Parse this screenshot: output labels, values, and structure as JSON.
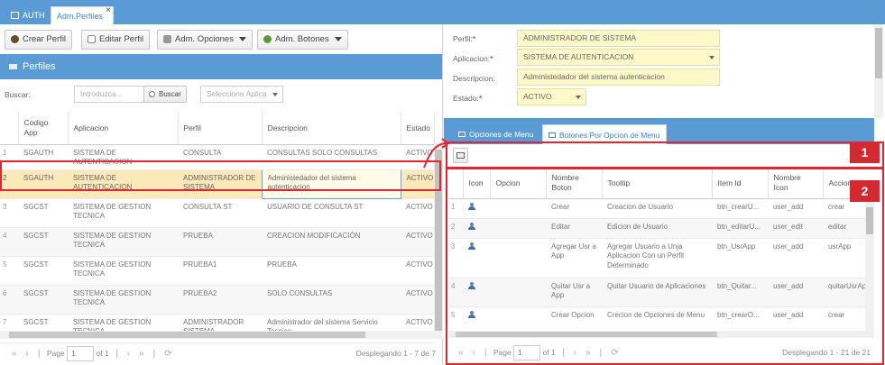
{
  "tabs": {
    "auth": "AUTH",
    "active": "Adm.Perfiles",
    "close": "×"
  },
  "toolbar": {
    "crear": "Crear Perfil",
    "editar": "Editar Perfil",
    "opciones": "Adm. Opciones",
    "botones": "Adm. Botones"
  },
  "left": {
    "title": "Perfiles",
    "search_label": "Buscar:",
    "search_placeholder": "Introduzca...",
    "search_button": "Buscar",
    "app_select_placeholder": "Seleccione Aplica",
    "columns": [
      "Codigo App",
      "Aplicacion",
      "Perfil",
      "Descripcion",
      "Estado"
    ],
    "rows": [
      {
        "n": "1",
        "codigo": "SGAUTH",
        "aplicacion": "SISTEMA DE AUTENTICACION",
        "perfil": "CONSULTA",
        "descripcion": "CONSULTAS SOLO CONSULTAS",
        "estado": "ACTIVO"
      },
      {
        "n": "2",
        "codigo": "SGAUTH",
        "aplicacion": "SISTEMA DE AUTENTICACION",
        "perfil": "ADMINISTRADOR DE SISTEMA",
        "descripcion": "Administedador del sistema autenticacion",
        "estado": "ACTIVO"
      },
      {
        "n": "3",
        "codigo": "SGCST",
        "aplicacion": "SISTEMA DE GESTION TECNICA",
        "perfil": "CONSULTA ST",
        "descripcion": "USUARIO DE CONSULTA ST",
        "estado": "ACTIVO"
      },
      {
        "n": "4",
        "codigo": "SGCST",
        "aplicacion": "SISTEMA DE GESTION TECNICA",
        "perfil": "PRUEBA",
        "descripcion": "CREACION MODIFICACIÓN",
        "estado": "ACTIVO"
      },
      {
        "n": "5",
        "codigo": "SGCST",
        "aplicacion": "SISTEMA DE GESTION TECNICA",
        "perfil": "PRUEBA1",
        "descripcion": "PRUEBA",
        "estado": "ACTIVO"
      },
      {
        "n": "6",
        "codigo": "SGCST",
        "aplicacion": "SISTEMA DE GESTION TECNICA",
        "perfil": "PRUEBA2",
        "descripcion": "SOLO CONSULTAS",
        "estado": "ACTIVO"
      },
      {
        "n": "7",
        "codigo": "SGCST",
        "aplicacion": "SISTEMA DE GESTION TECNICA",
        "perfil": "ADMINISTRADOR SISTEMA",
        "descripcion": "Administrador del sistema Servicio Tecnico",
        "estado": "ACTIVO"
      }
    ],
    "pager": {
      "page_label": "Page",
      "page_value": "1",
      "of": "of 1",
      "display": "Desplegando 1 - 7 de 7"
    }
  },
  "form": {
    "perfil_label": "Perfil:",
    "perfil_value": "ADMINISTRADOR DE SISTEMA",
    "app_label": "Aplicacion:",
    "app_value": "SISTEMA DE AUTENTICACION",
    "desc_label": "Descripcion:",
    "desc_value": "Administedador del sistema autenticacion",
    "estado_label": "Estado:",
    "estado_value": "ACTIVO",
    "required": "*"
  },
  "right_tabs": {
    "opciones": "Opciones de Menu",
    "botones": "Botones Por Opcion de Menu"
  },
  "right": {
    "columns": [
      "Icon",
      "Opcion",
      "Nombre Boton",
      "Tooltip",
      "Item Id",
      "Nombre Icon",
      "Accion"
    ],
    "rows": [
      {
        "n": "1",
        "icon": "user-icon",
        "opcion": "",
        "boton": "Crear",
        "tooltip": "Creacion de Usuario",
        "item": "btn_crearU...",
        "nicon": "user_add",
        "accion": "crear"
      },
      {
        "n": "2",
        "icon": "user-edit-icon",
        "opcion": "",
        "boton": "Editar",
        "tooltip": "Edicion de Usuario",
        "item": "btn_editarU...",
        "nicon": "user_edit",
        "accion": "editar"
      },
      {
        "n": "3",
        "icon": "user-icon",
        "opcion": "",
        "boton": "Agregar Usr a App",
        "tooltip": "Agregar Usuario a Unja Aplicacion Con un Perfil Determinado",
        "item": "btn_UsrApp",
        "nicon": "user_add",
        "accion": "usrApp"
      },
      {
        "n": "4",
        "icon": "user-icon",
        "opcion": "",
        "boton": "Quitar Usr a App",
        "tooltip": "Quitar Usuario de Aplicaciones",
        "item": "btn_Quitar...",
        "nicon": "user_add",
        "accion": "quitarUsrAp"
      },
      {
        "n": "5",
        "icon": "user-icon",
        "opcion": "",
        "boton": "Crear Opcion",
        "tooltip": "Crecion de Opciones de Menu",
        "item": "btn_crearO...",
        "nicon": "user_add",
        "accion": "crear"
      }
    ],
    "pager": {
      "page_label": "Page",
      "page_value": "1",
      "of": "of 1",
      "display": "Desplegando 1 - 21 de 21"
    }
  },
  "badges": {
    "b1": "1",
    "b2": "2"
  },
  "colors": {
    "header_blue": "#5b9bd5",
    "highlight_red": "#e3262e",
    "selected_row": "#fbe9b9",
    "required_field": "#fff9c9"
  }
}
